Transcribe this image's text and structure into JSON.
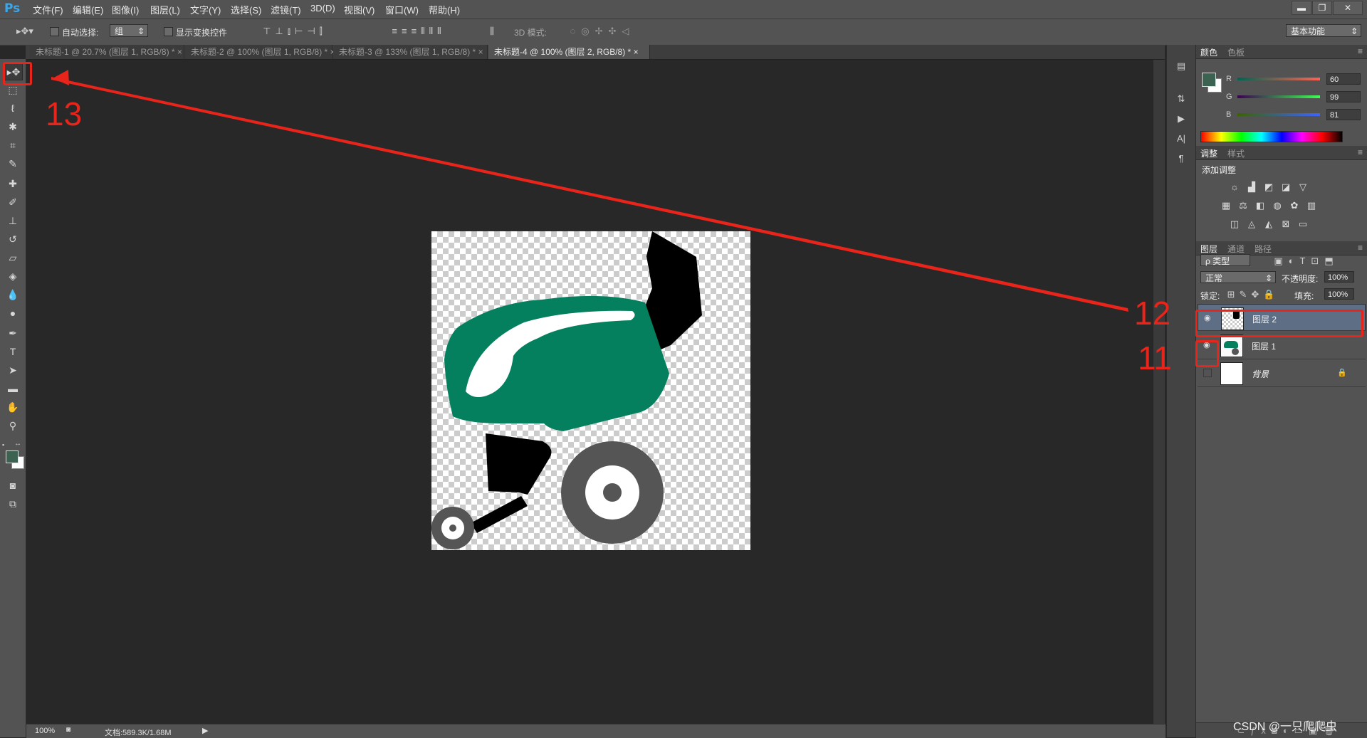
{
  "app": {
    "logo": "Ps"
  },
  "menu": [
    "文件(F)",
    "编辑(E)",
    "图像(I)",
    "图层(L)",
    "文字(Y)",
    "选择(S)",
    "滤镜(T)",
    "3D(D)",
    "视图(V)",
    "窗口(W)",
    "帮助(H)"
  ],
  "window_controls": {
    "minimize": "▬",
    "restore": "❐",
    "close": "✕"
  },
  "options": {
    "auto_select_label": "自动选择:",
    "auto_select_value": "组",
    "show_transform_label": "显示变换控件",
    "mode3d_label": "3D 模式:",
    "workspace": "基本功能"
  },
  "tabs": [
    {
      "label": "未标题-1 @ 20.7% (图层 1, RGB/8) *",
      "close": "×"
    },
    {
      "label": "未标题-2 @ 100% (图层 1, RGB/8) *",
      "close": "×"
    },
    {
      "label": "未标题-3 @ 133% (图层 1, RGB/8) *",
      "close": "×"
    },
    {
      "label": "未标题-4 @ 100% (图层 2, RGB/8) *",
      "close": "×"
    }
  ],
  "status": {
    "zoom": "100%",
    "doc": "文档:589.3K/1.68M"
  },
  "color_panel": {
    "tabs": [
      "颜色",
      "色板"
    ],
    "r_label": "R",
    "r_value": "60",
    "g_label": "G",
    "g_value": "99",
    "b_label": "B",
    "b_value": "81",
    "foreground": "#3c6351"
  },
  "adjust_panel": {
    "tabs": [
      "调整",
      "样式"
    ],
    "title": "添加调整"
  },
  "layers_panel": {
    "tabs": [
      "图层",
      "通道",
      "路径"
    ],
    "filter_kind": "ρ 类型",
    "blend_mode": "正常",
    "opacity_label": "不透明度:",
    "opacity_value": "100%",
    "lock_label": "锁定:",
    "fill_label": "填充:",
    "fill_value": "100%",
    "layers": [
      {
        "name": "图层 2",
        "visible": true,
        "selected": true
      },
      {
        "name": "图层 1",
        "visible": true,
        "selected": false
      },
      {
        "name": "背景",
        "visible": false,
        "selected": false
      }
    ]
  },
  "annotations": {
    "a11": "11",
    "a12": "12",
    "a13": "13"
  },
  "watermark": "CSDN @一只爬爬虫",
  "colors": {
    "accent_red": "#e8241b",
    "tractor_green": "#04805e",
    "selected_layer": "#5d6e85"
  }
}
